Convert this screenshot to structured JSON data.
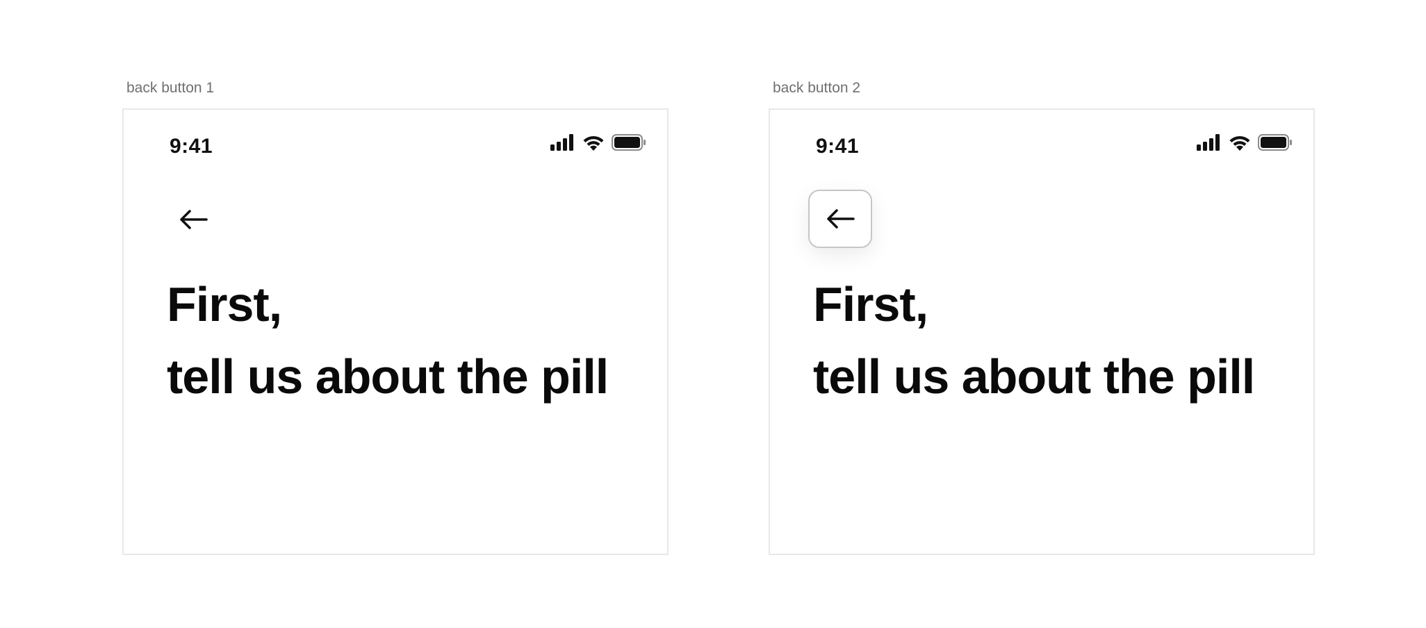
{
  "frames": [
    {
      "label": "back button 1",
      "status_time": "9:41",
      "back_style": "plain",
      "headline_line1": "First,",
      "headline_line2": "tell us about the pill"
    },
    {
      "label": "back button 2",
      "status_time": "9:41",
      "back_style": "boxed",
      "headline_line1": "First,",
      "headline_line2": "tell us about the pill"
    }
  ],
  "icons": {
    "back": "arrow-left-icon",
    "signal": "cellular-signal-icon",
    "wifi": "wifi-icon",
    "battery": "battery-icon"
  },
  "colors": {
    "text": "#0a0a0a",
    "frame_border": "#e8e8e8",
    "label": "#6f6f6f",
    "button_border": "#c6c6c6"
  }
}
